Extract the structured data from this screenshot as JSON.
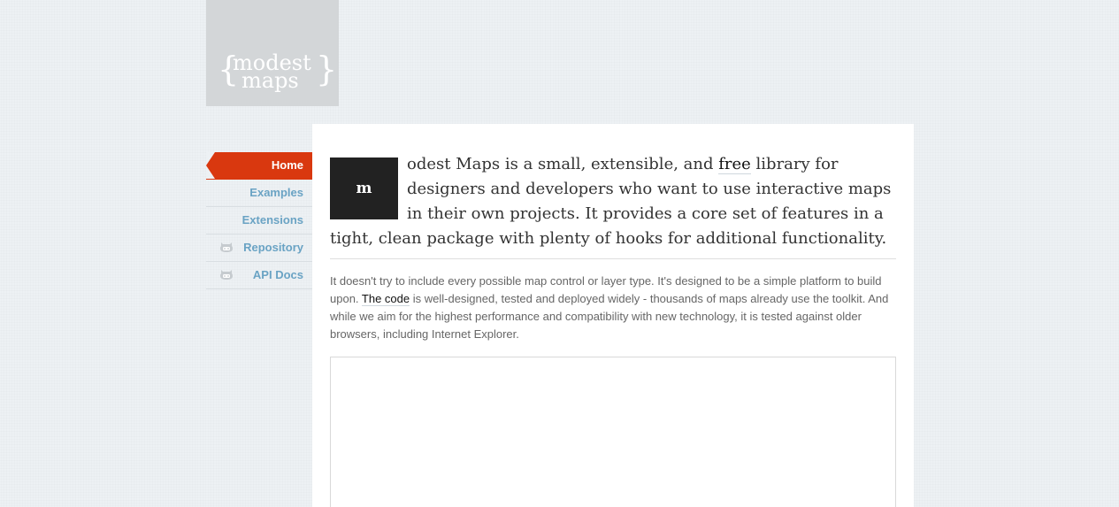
{
  "logo": {
    "brace_open": "{",
    "word1": "modest",
    "word2": "maps",
    "brace_close": "}"
  },
  "nav": {
    "items": [
      {
        "label": "Home",
        "active": true,
        "icon": null
      },
      {
        "label": "Examples",
        "active": false,
        "icon": null
      },
      {
        "label": "Extensions",
        "active": false,
        "icon": null
      },
      {
        "label": "Repository",
        "active": false,
        "icon": "github-icon"
      },
      {
        "label": "API Docs",
        "active": false,
        "icon": "github-icon"
      }
    ]
  },
  "intro": {
    "dropcap": "m",
    "text_before_link": "odest Maps is a small, extensible, and ",
    "link": "free",
    "text_after_link": " library for designers and developers who want to use interactive maps in their own projects. It provides a core set of features in a tight, clean package with plenty of hooks for additional functionality."
  },
  "description": {
    "text_before_link": "It doesn't try to include every possible map control or layer type. It's designed to be a simple platform to build upon. ",
    "link": "The code",
    "text_after_link": " is well-designed, tested and deployed widely - thousands of maps already use the toolkit. And while we aim for the highest performance and compatibility with new technology, it is tested against older browsers, including Internet Explorer."
  },
  "colors": {
    "accent": "#d9380f",
    "nav_link": "#6aa3c4",
    "background": "#edf1f4",
    "logo_bg": "#d3d6d8",
    "dropcap_bg": "#222222"
  }
}
